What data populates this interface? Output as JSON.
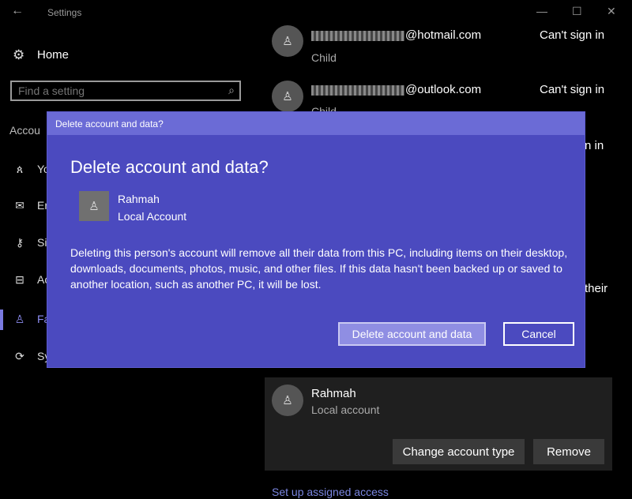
{
  "window": {
    "title": "Settings",
    "back_glyph": "←",
    "minimize_glyph": "—",
    "maximize_glyph": "☐",
    "close_glyph": "✕"
  },
  "sidebar": {
    "home_icon": "⚙",
    "home_label": "Home",
    "search_placeholder": "Find a setting",
    "search_icon": "⌕",
    "section_label": "Accou",
    "items": [
      {
        "icon": "person-list-icon",
        "glyph": "ጰ",
        "label": "Yo"
      },
      {
        "icon": "mail-icon",
        "glyph": "✉",
        "label": "Er"
      },
      {
        "icon": "key-icon",
        "glyph": "⚷",
        "label": "Si"
      },
      {
        "icon": "briefcase-icon",
        "glyph": "⊟",
        "label": "Ac"
      },
      {
        "icon": "person-icon",
        "glyph": "♙",
        "label": "Fa"
      },
      {
        "icon": "sync-icon",
        "glyph": "⟳",
        "label": "Sy"
      }
    ]
  },
  "accounts": [
    {
      "email_suffix": "@hotmail.com",
      "subtitle": "Child",
      "status": "Can't sign in"
    },
    {
      "email_suffix": "@outlook.com",
      "subtitle": "Child",
      "status": "Can't sign in"
    },
    {
      "status": "n in"
    }
  ],
  "partial_text": "their",
  "local_account": {
    "name": "Rahmah",
    "type": "Local account",
    "change_type_button": "Change account type",
    "remove_button": "Remove"
  },
  "assigned_access_link": "Set up assigned access",
  "dialog": {
    "titlebar": "Delete account and data?",
    "heading": "Delete account and data?",
    "user_name": "Rahmah",
    "user_type": "Local Account",
    "body": "Deleting this person's account will remove all their data from this PC, including items on their desktop, downloads, documents, photos, music, and other files. If this data hasn't been backed up or saved to another location, such as another PC, it will be lost.",
    "delete_button": "Delete account and data",
    "cancel_button": "Cancel"
  },
  "avatar_glyph": "♙",
  "colors": {
    "dialog_bg": "#4b4abf",
    "dialog_titlebar": "#6b6bd6",
    "primary_button": "#8f8ee3",
    "link": "#7a86e0"
  }
}
